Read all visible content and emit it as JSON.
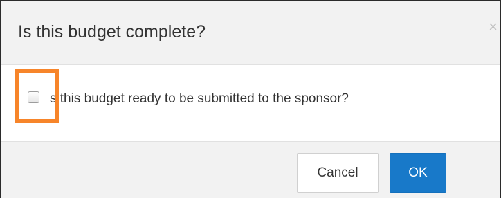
{
  "dialog": {
    "title": "Is this budget complete?",
    "close_symbol": "×"
  },
  "body": {
    "checkbox_checked": false,
    "question_text": "s this budget ready to be submitted to the sponsor?"
  },
  "footer": {
    "cancel_label": "Cancel",
    "ok_label": "OK"
  },
  "colors": {
    "highlight": "#f7852a",
    "primary_button": "#1879c9"
  }
}
